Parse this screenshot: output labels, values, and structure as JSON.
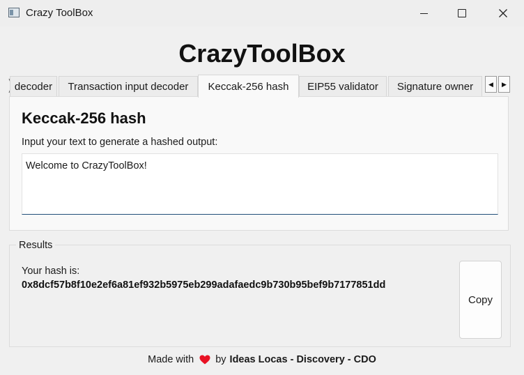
{
  "window": {
    "title": "Crazy ToolBox"
  },
  "app": {
    "title": "CrazyToolBox"
  },
  "tabs": [
    {
      "label": "decoder",
      "active": false
    },
    {
      "label": "Transaction input decoder",
      "active": false
    },
    {
      "label": "Keccak-256 hash",
      "active": true
    },
    {
      "label": "EIP55 validator",
      "active": false
    },
    {
      "label": "Signature owner",
      "active": false
    }
  ],
  "panel": {
    "heading": "Keccak-256 hash",
    "input_label": "Input your text to generate a hashed output:",
    "input_value": "Welcome to CrazyToolBox!"
  },
  "results": {
    "group_title": "Results",
    "hash_label": "Your hash is:",
    "hash_value": "0x8dcf57b8f10e2ef6a81ef932b5975eb299adafaedc9b730b95bef9b7177851dd",
    "copy_label": "Copy"
  },
  "footer": {
    "made_with": "Made with",
    "by": "by",
    "credits": "Ideas Locas - Discovery - CDO"
  },
  "icons": {
    "heart_color": "#e81224",
    "accent_color": "#1f4e79"
  }
}
